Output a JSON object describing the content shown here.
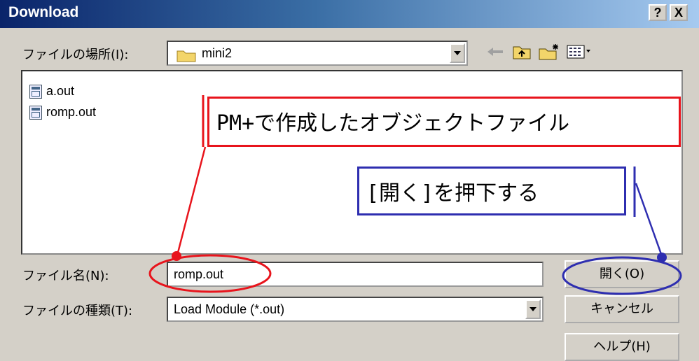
{
  "window": {
    "title": "Download",
    "help_btn": "?",
    "close_btn": "X"
  },
  "location": {
    "label": "ファイルの場所(I):",
    "value": "mini2"
  },
  "files": [
    {
      "name": "a.out"
    },
    {
      "name": "romp.out"
    }
  ],
  "filename": {
    "label": "ファイル名(N):",
    "value": "romp.out"
  },
  "filetype": {
    "label": "ファイルの種類(T):",
    "value": "Load Module (*.out)"
  },
  "buttons": {
    "open": "開く(O)",
    "cancel": "キャンセル",
    "help": "ヘルプ(H)"
  },
  "annotations": {
    "object_file": "PM+で作成したオブジェクトファイル",
    "press_open": "[開く]を押下する"
  },
  "colors": {
    "annotation_red": "#e8141c",
    "annotation_blue": "#2e2eb0"
  },
  "icons": [
    "folder-icon",
    "back-arrow-icon",
    "up-folder-icon",
    "new-folder-icon",
    "view-menu-icon",
    "file-icon"
  ]
}
